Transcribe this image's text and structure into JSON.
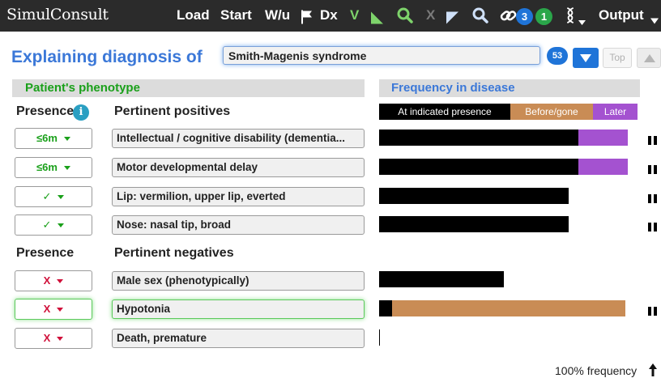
{
  "topbar": {
    "logo": "SimulConsult",
    "load": "Load",
    "start": "Start",
    "wu": "W/u",
    "dx": "Dx",
    "v": "V",
    "x": "X",
    "badge_blue": "3",
    "badge_green": "1",
    "output": "Output",
    "colors": {
      "background": "#2b2b2b",
      "green": "#7ed36b",
      "blue_badge": "#1f74d8",
      "green_badge": "#2aa64a"
    }
  },
  "heading": {
    "title": "Explaining diagnosis of",
    "diagnosis_value": "Smith-Magenis syndrome",
    "count": "53",
    "top_label": "Top"
  },
  "left_section": {
    "title": "Patient's phenotype",
    "presence_header": "Presence",
    "info_icon": "i",
    "positives_header": "Pertinent positives",
    "negatives_header": "Pertinent negatives"
  },
  "right_section": {
    "title": "Frequency in disease",
    "legend": {
      "at_presence": "At indicated presence",
      "before_gone": "Before/gone",
      "later": "Later"
    },
    "colors": {
      "at_presence": "#000000",
      "before_gone": "#c98c55",
      "later": "#a452d0"
    }
  },
  "positives": [
    {
      "presence": "≤6m",
      "finding": "Intellectual / cognitive disability (dementia...",
      "freq_at": 0.77,
      "freq_before": 0.0,
      "freq_later": 0.19,
      "pause": true
    },
    {
      "presence": "≤6m",
      "finding": "Motor developmental delay",
      "freq_at": 0.77,
      "freq_before": 0.0,
      "freq_later": 0.19,
      "pause": true
    },
    {
      "presence": "✓",
      "finding": "Lip: vermilion, upper lip, everted",
      "freq_at": 0.73,
      "freq_before": 0.0,
      "freq_later": 0.0,
      "pause": true
    },
    {
      "presence": "✓",
      "finding": "Nose: nasal tip, broad",
      "freq_at": 0.73,
      "freq_before": 0.0,
      "freq_later": 0.0,
      "pause": true
    }
  ],
  "negatives": [
    {
      "presence": "X",
      "finding": "Male sex (phenotypically)",
      "freq_at": 0.48,
      "freq_before": 0.0,
      "freq_later": 0.0,
      "pause": false
    },
    {
      "presence": "X",
      "finding": "Hypotonia",
      "freq_at": 0.05,
      "freq_before": 0.9,
      "freq_later": 0.0,
      "pause": true,
      "highlighted": true
    },
    {
      "presence": "X",
      "finding": "Death, premature",
      "freq_at": 0.0,
      "freq_before": 0.0,
      "freq_later": 0.0,
      "pause": false
    }
  ],
  "footer": {
    "note": "100% frequency"
  }
}
